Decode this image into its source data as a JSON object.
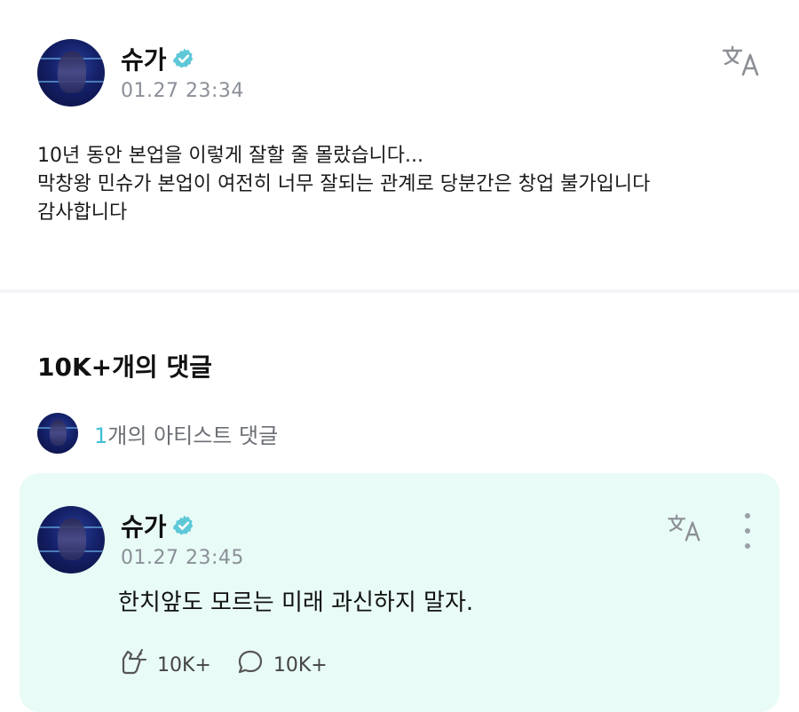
{
  "post": {
    "author": "슈가",
    "timestamp": "01.27 23:34",
    "lines": [
      "10년 동안 본업을 이렇게 잘할 줄 몰랐습니다...",
      "막창왕 민슈가 본업이 여전히 너무 잘되는 관계로 당분간은 창업 불가입니다",
      "감사합니다"
    ]
  },
  "comments": {
    "title": "10K+개의 댓글",
    "artist_count": "1",
    "artist_label": "개의 아티스트 댓글"
  },
  "artist_comment": {
    "author": "슈가",
    "timestamp": "01.27 23:45",
    "text": "한치앞도 모르는 미래 과신하지 말자.",
    "likes": "10K+",
    "replies": "10K+"
  },
  "icons": {
    "verified": "verified-badge-icon",
    "translate": "translate-icon",
    "like": "like-icon",
    "reply": "reply-bubble-icon",
    "more": "more-vertical-icon"
  },
  "colors": {
    "accent": "#3fbfd6",
    "verified": "#5ec8d8",
    "card_bg": "#e8fbf6",
    "muted_text": "#8a8f98"
  }
}
